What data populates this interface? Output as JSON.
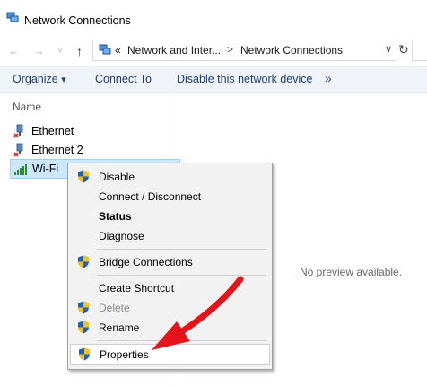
{
  "window": {
    "title": "Network Connections"
  },
  "address_bar": {
    "overflow": "«",
    "segments": [
      "Network and Inter...",
      "Network Connections"
    ],
    "separator": ">"
  },
  "nav": {
    "back": "←",
    "forward": "→",
    "recent": "˅",
    "up": "↑"
  },
  "command_bar": {
    "organize": "Organize",
    "organize_caret": "▾",
    "connect_to": "Connect To",
    "disable_device": "Disable this network device",
    "more": "»"
  },
  "list": {
    "column_header": "Name",
    "items": [
      {
        "label": "Ethernet",
        "icon": "ethernet-disconnected-icon",
        "selected": false
      },
      {
        "label": "Ethernet 2",
        "icon": "ethernet-disconnected-icon",
        "selected": false
      },
      {
        "label": "Wi-Fi",
        "icon": "wifi-signal-icon",
        "selected": true
      }
    ]
  },
  "preview": {
    "text": "No preview available."
  },
  "context_menu": {
    "items": [
      {
        "label": "Disable",
        "shield": true
      },
      {
        "label": "Connect / Disconnect",
        "shield": false
      },
      {
        "label": "Status",
        "shield": false,
        "bold": true
      },
      {
        "label": "Diagnose",
        "shield": false
      },
      {
        "label": "Bridge Connections",
        "shield": true
      },
      {
        "label": "Create Shortcut",
        "shield": false
      },
      {
        "label": "Delete",
        "shield": true,
        "disabled": true
      },
      {
        "label": "Rename",
        "shield": true
      },
      {
        "label": "Properties",
        "shield": true,
        "highlighted": true
      }
    ]
  },
  "colors": {
    "accent_selected": "#cce8ff",
    "annotation_arrow": "#e3141b",
    "command_text": "#1e3c72"
  }
}
